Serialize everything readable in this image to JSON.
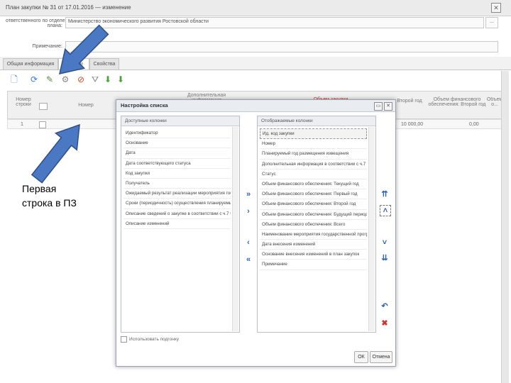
{
  "window": {
    "title": "План закупки № 31 от 17.01.2016 — изменение",
    "close_glyph": "✕"
  },
  "form": {
    "org_label_line1": "ответственного по отделению",
    "org_label_line2": "плана:",
    "org_value": "Министерство экономического развития Ростовской области",
    "org_button": "...",
    "note_label": "Примечание:",
    "note_value": ""
  },
  "tabs": [
    {
      "label": "Общая информация"
    },
    {
      "label": "Закупки"
    },
    {
      "label": "Свойства"
    }
  ],
  "toolbar": {
    "icons": [
      "add-icon",
      "refresh-icon",
      "edit-icon",
      "settings-icon",
      "filter-clear-icon",
      "filter-icon",
      "arrow-down-green-icon",
      "arrow-down-green-2-icon"
    ]
  },
  "grid": {
    "col_row_number": "Номер строки",
    "col_number": "Номер",
    "col_extra": "Дополнительная информация",
    "col_purchase": "Объем закупки",
    "col_second_year": "Объем финансового обеспечения: Второй год",
    "col_truncated": "Объем о...",
    "col_year_short": "Второй год",
    "row_number": "1",
    "row_value_1": "10 000,00",
    "row_value_2": "0,00"
  },
  "dialog": {
    "title": "Настройка списка",
    "restore_glyph": "▭",
    "close_glyph": "✕",
    "available_header": "Доступные колонки",
    "available": [
      "Идентификатор",
      "Основание",
      "Дата",
      "Дата соответствующего статуса",
      "Код закупки",
      "Получатель",
      "Ожидаемый результат реализации мероприятия гос...",
      "Сроки (периодичность) осуществления планируемы...",
      "Описание сведений о закупке в соответствии с ч.7 ч...",
      "Описание изменений"
    ],
    "displayed_header": "Отображаемые колонки",
    "displayed": [
      "Ид. код закупки",
      "Номер",
      "Планируемый год размещения извещения",
      "Дополнительная информация в соответствии с ч.7 ч...",
      "Статус",
      "Объем финансового обеспечения: Текущий год",
      "Объем финансового обеспечения: Первый год",
      "Объем финансового обеспечения: Второй год",
      "Объем финансового обеспечения: Будущий период",
      "Объем финансового обеспечения: Всего",
      "Наименование мероприятия государственной прогр...",
      "Дата внесения изменений",
      "Основание внесения изменений в план закупок",
      "Примечание"
    ],
    "move_all_right": "»",
    "move_right": "›",
    "move_left": "‹",
    "move_all_left": "«",
    "to_top": "⇈",
    "up": "˄",
    "down": "˅",
    "to_bottom": "⇊",
    "reset": "↶",
    "delete": "✖",
    "autofit_label": "Использовать подгонку",
    "ok_label": "ОК",
    "cancel_label": "Отмена"
  },
  "annotation": {
    "line1": "Первая",
    "line2": "строка в ПЗ",
    "arrow_color": "#4a78c2"
  }
}
